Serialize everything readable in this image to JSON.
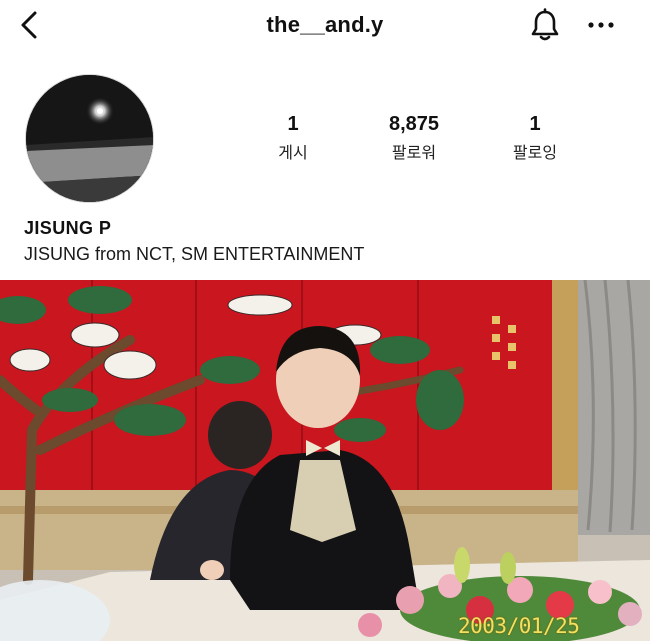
{
  "header": {
    "username": "the__and.y"
  },
  "profile": {
    "display_name": "JISUNG P",
    "bio": "JISUNG from NCT, SM ENTERTAINMENT"
  },
  "stats": {
    "posts": {
      "count": "1",
      "label": "게시"
    },
    "followers": {
      "count": "8,875",
      "label": "팔로워"
    },
    "following": {
      "count": "1",
      "label": "팔로잉"
    }
  },
  "post": {
    "date_stamp": "2003/01/25"
  },
  "icons": {
    "back": "chevron-left-icon",
    "notifications": "bell-icon",
    "more": "more-horizontal-icon"
  }
}
